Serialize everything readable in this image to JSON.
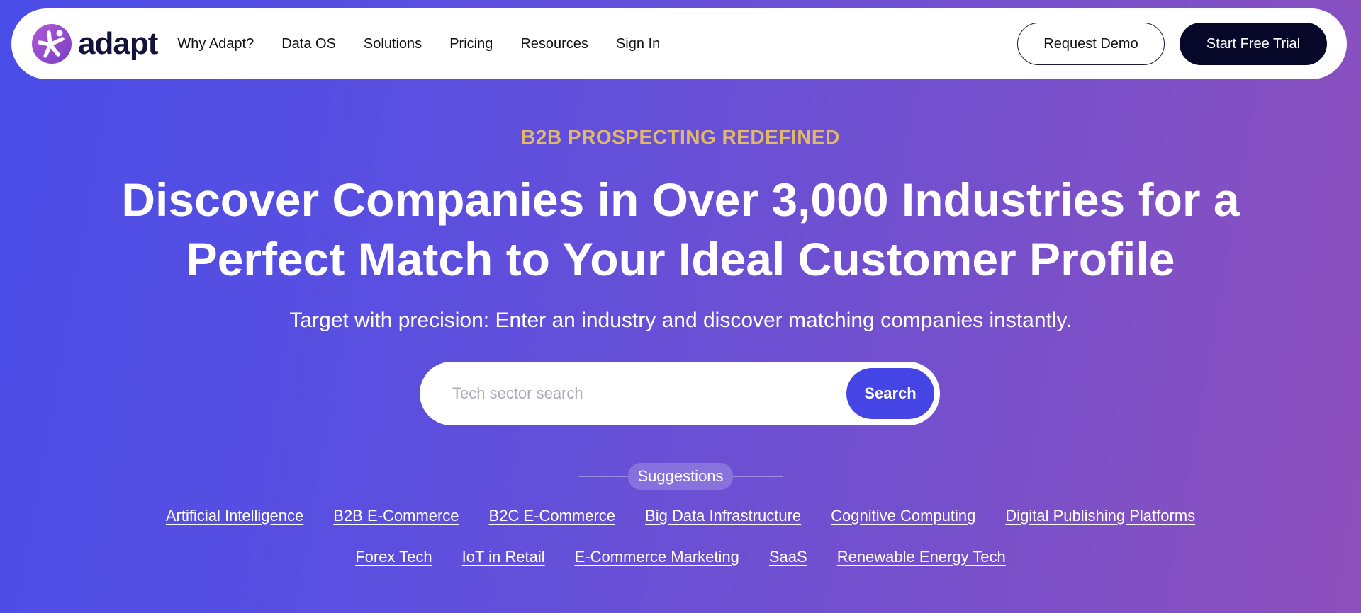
{
  "brand": {
    "name": "adapt",
    "accent": "#4545e6",
    "dark": "#07072a",
    "eyebrow_color": "#e2b86a"
  },
  "nav": {
    "links": [
      "Why Adapt?",
      "Data OS",
      "Solutions",
      "Pricing",
      "Resources",
      "Sign In"
    ],
    "request_demo": "Request Demo",
    "free_trial": "Start Free Trial"
  },
  "hero": {
    "eyebrow": "B2B PROSPECTING REDEFINED",
    "headline_line1": "Discover Companies in Over 3,000 Industries for a",
    "headline_line2": "Perfect Match to Your Ideal Customer Profile",
    "subtitle": "Target with precision: Enter an industry and discover matching companies instantly."
  },
  "search": {
    "placeholder": "Tech sector search",
    "button": "Search"
  },
  "suggestions": {
    "label": "Suggestions",
    "row1": [
      "Artificial Intelligence",
      "B2B E-Commerce",
      "B2C E-Commerce",
      "Big Data Infrastructure",
      "Cognitive Computing",
      "Digital Publishing Platforms"
    ],
    "row2": [
      "Forex Tech",
      "IoT in Retail",
      "E-Commerce Marketing",
      "SaaS",
      "Renewable Energy Tech"
    ]
  }
}
